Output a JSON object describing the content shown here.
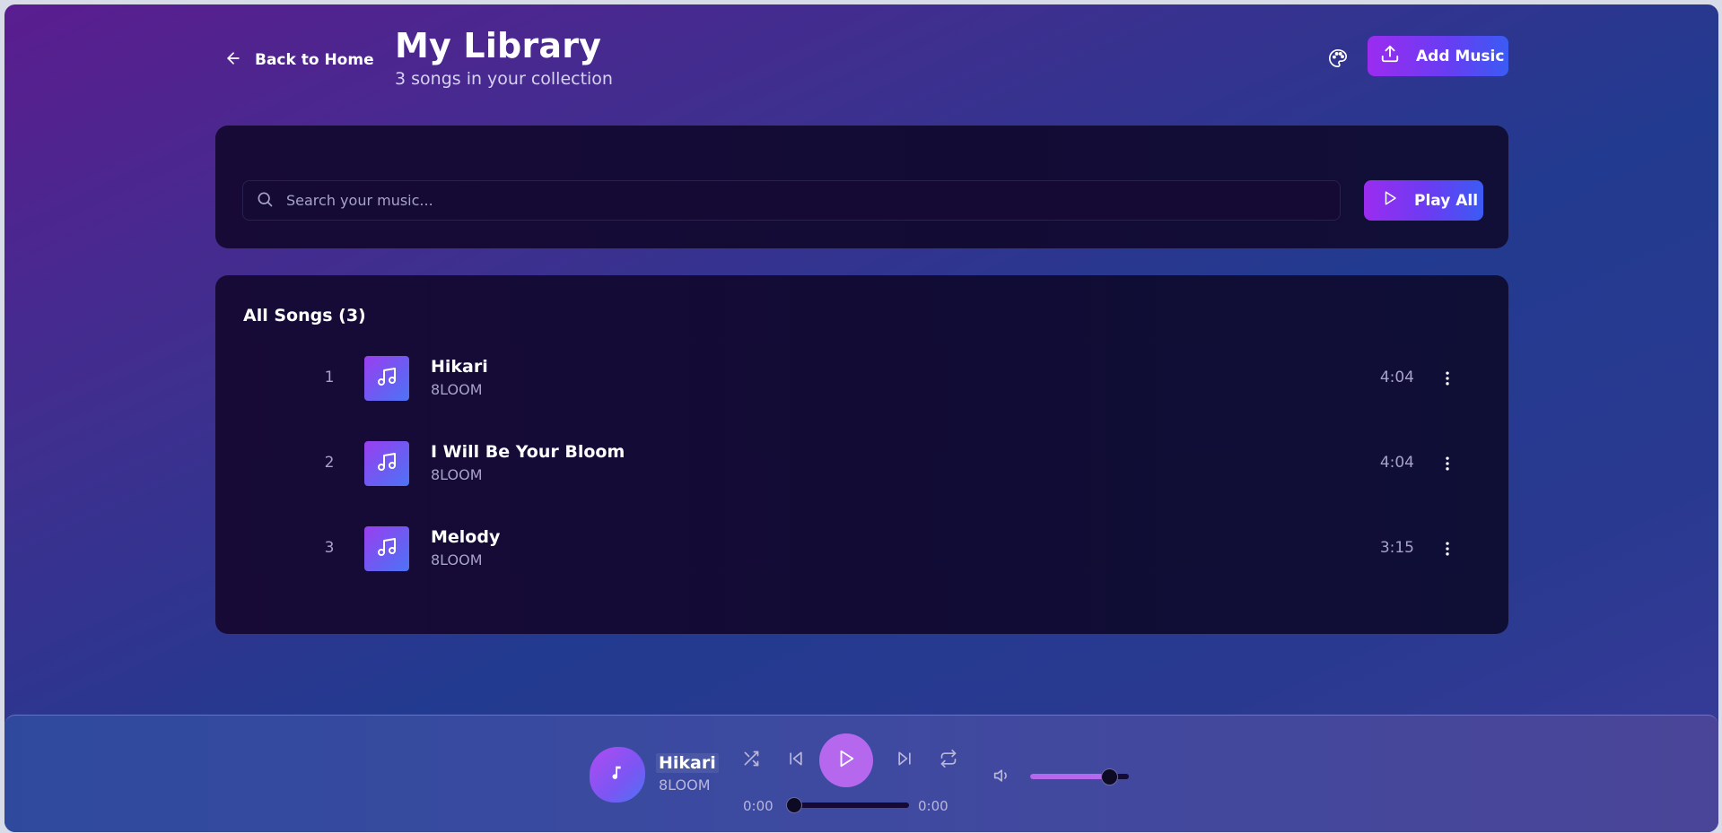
{
  "header": {
    "back_label": "Back to Home",
    "title": "My Library",
    "subtitle": "3 songs in your collection",
    "add_music_label": "Add Music"
  },
  "search": {
    "placeholder": "Search your music...",
    "value": "",
    "play_all_label": "Play All"
  },
  "songs": {
    "heading": "All Songs (3)",
    "items": [
      {
        "index": "1",
        "title": "Hikari",
        "artist": "8LOOM",
        "duration": "4:04"
      },
      {
        "index": "2",
        "title": "I Will Be Your Bloom",
        "artist": "8LOOM",
        "duration": "4:04"
      },
      {
        "index": "3",
        "title": "Melody",
        "artist": "8LOOM",
        "duration": "3:15"
      }
    ]
  },
  "player": {
    "title": "Hikari",
    "artist": "8LOOM",
    "current_time": "0:00",
    "total_time": "0:00",
    "progress": 0,
    "volume": 0.8
  },
  "colors": {
    "accent": "#b567ee",
    "button_gradient_start": "#9b2cf0",
    "button_gradient_end": "#3b5bf4",
    "card_background": "#120c35",
    "muted_text": "#a8a2c8"
  },
  "icons": {
    "back": "arrow-left-icon",
    "palette": "palette-icon",
    "upload": "upload-icon",
    "search": "search-icon",
    "play": "play-icon",
    "song_art": "music-note-icon",
    "menu": "more-vertical-icon",
    "shuffle": "shuffle-icon",
    "previous": "skip-back-icon",
    "next": "skip-forward-icon",
    "repeat": "repeat-icon",
    "volume": "volume-icon"
  }
}
